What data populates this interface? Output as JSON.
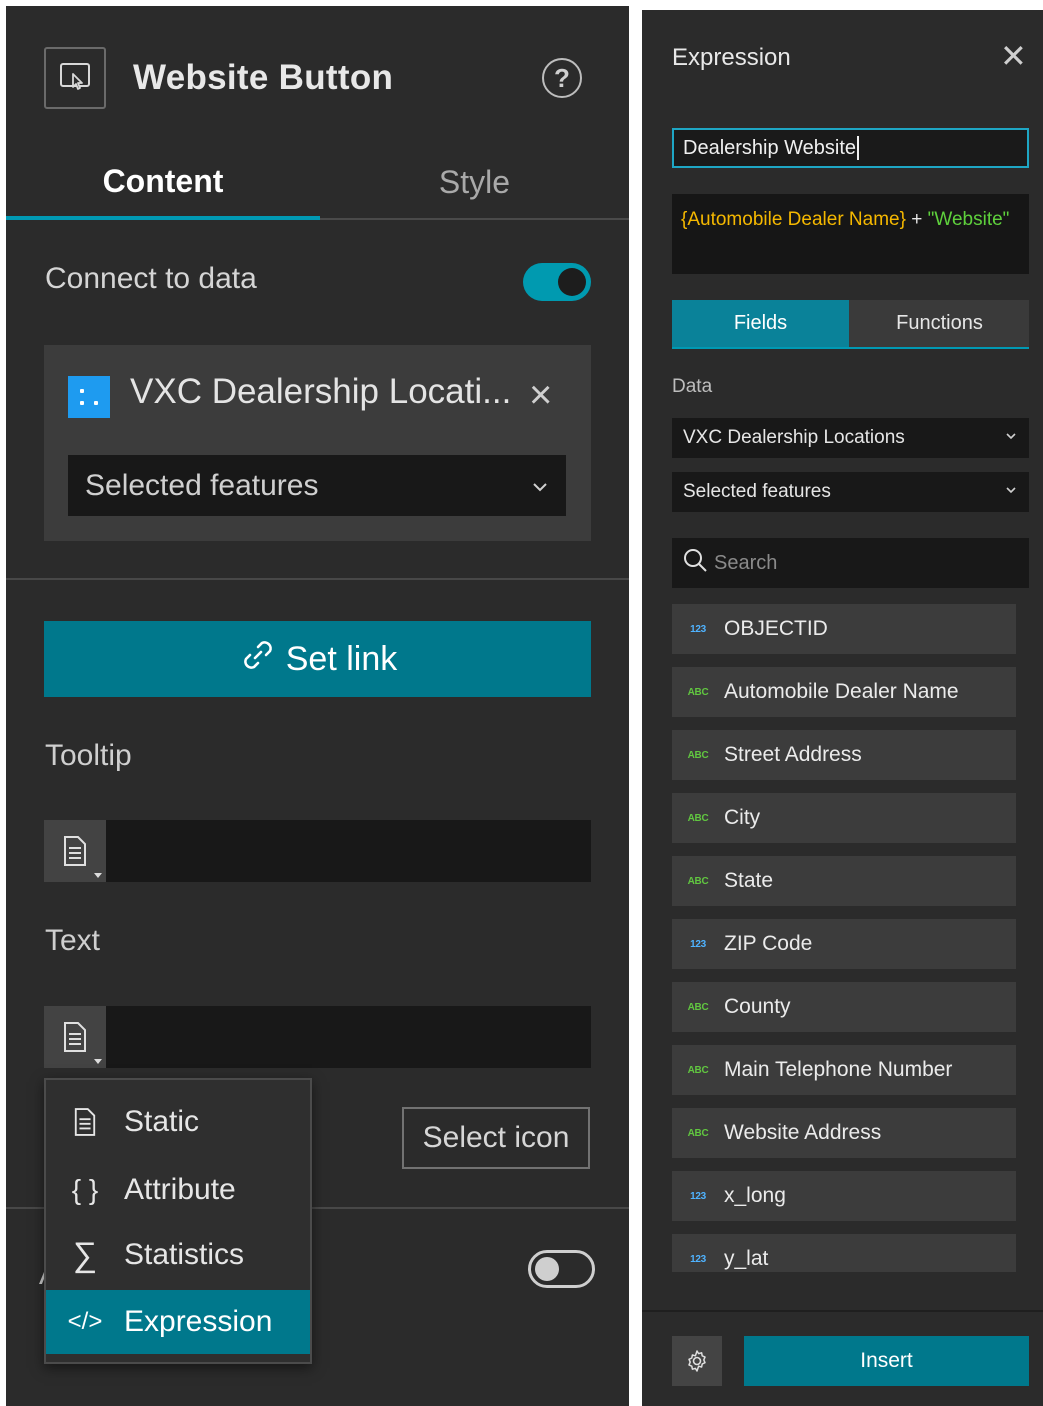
{
  "left_panel": {
    "title": "Website Button",
    "tabs": [
      {
        "label": "Content",
        "active": true
      },
      {
        "label": "Style",
        "active": false
      }
    ],
    "connect_to_data": {
      "label": "Connect to data",
      "enabled": true
    },
    "data_source": {
      "name": "VXC Dealership Locati...",
      "selection": "Selected features"
    },
    "set_link_label": "Set link",
    "tooltip_label": "Tooltip",
    "text_label": "Text",
    "select_icon_label": "Select icon",
    "hidden_toggle_enabled": false,
    "partial_label_fragment": "A",
    "dropdown_menu": [
      {
        "label": "Static",
        "icon": "document-icon",
        "active": false
      },
      {
        "label": "Attribute",
        "icon": "braces-icon",
        "active": false
      },
      {
        "label": "Statistics",
        "icon": "sigma-icon",
        "active": false
      },
      {
        "label": "Expression",
        "icon": "code-icon",
        "active": true
      }
    ]
  },
  "expression_panel": {
    "title": "Expression",
    "name_value": "Dealership Website",
    "expression": {
      "field": "{Automobile Dealer Name}",
      "operator": " + ",
      "string": " \"Website\""
    },
    "tabs": [
      {
        "label": "Fields",
        "active": true
      },
      {
        "label": "Functions",
        "active": false
      }
    ],
    "data_label": "Data",
    "data_source": "VXC Dealership Locations",
    "selection": "Selected features",
    "search_placeholder": "Search",
    "fields": [
      {
        "name": "OBJECTID",
        "type": "123"
      },
      {
        "name": "Automobile Dealer Name",
        "type": "ABC"
      },
      {
        "name": "Street Address",
        "type": "ABC"
      },
      {
        "name": "City",
        "type": "ABC"
      },
      {
        "name": "State",
        "type": "ABC"
      },
      {
        "name": "ZIP Code",
        "type": "123"
      },
      {
        "name": "County",
        "type": "ABC"
      },
      {
        "name": "Main Telephone Number",
        "type": "ABC"
      },
      {
        "name": "Website Address",
        "type": "ABC"
      },
      {
        "name": "x_long",
        "type": "123"
      },
      {
        "name": "y_lat",
        "type": "123"
      }
    ],
    "insert_label": "Insert"
  },
  "colors": {
    "accent": "#00788c",
    "toggle_on": "#009ab0",
    "field_token": "#f5b800",
    "string_token": "#5ed03c",
    "number_type": "#4fb3ff",
    "string_type": "#61c640"
  }
}
